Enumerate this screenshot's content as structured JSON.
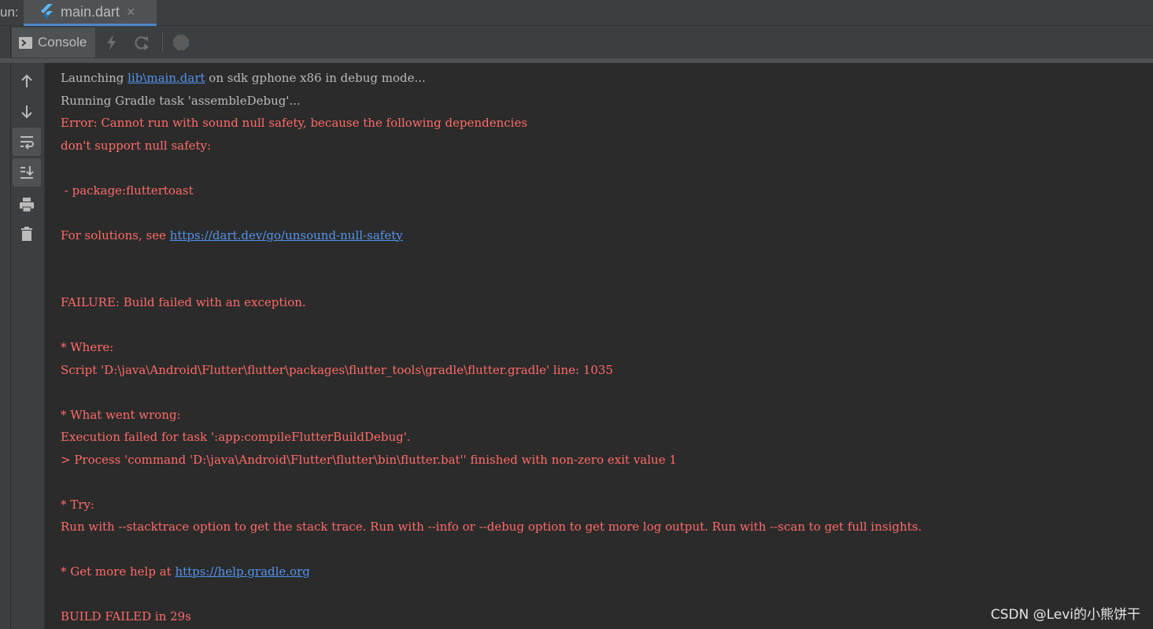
{
  "run_label": "un:",
  "tab": {
    "name": "main.dart",
    "close": "×",
    "icon": "flutter-icon"
  },
  "toolbar": {
    "console_label": "Console",
    "icons": [
      "console-icon",
      "lightning-icon",
      "hot-restart-icon",
      "stop-icon"
    ]
  },
  "gutter_icons": [
    "arrow-up-icon",
    "arrow-down-icon",
    "soft-wrap-icon",
    "scroll-to-end-icon",
    "print-icon",
    "trash-icon"
  ],
  "console": {
    "l1_pre": "Launching ",
    "l1_link": "lib\\main.dart",
    "l1_post": " on sdk gphone x86 in debug mode...",
    "l2": "Running Gradle task 'assembleDebug'...",
    "l3": "Error: Cannot run with sound null safety, because the following dependencies",
    "l4": "don't support null safety:",
    "l6": " - package:fluttertoast",
    "l8_pre": "For solutions, see ",
    "l8_link": "https://dart.dev/go/unsound-null-safety",
    "l11": "FAILURE: Build failed with an exception.",
    "l13": "* Where:",
    "l14": "Script 'D:\\java\\Android\\Flutter\\flutter\\packages\\flutter_tools\\gradle\\flutter.gradle' line: 1035",
    "l16": "* What went wrong:",
    "l17": "Execution failed for task ':app:compileFlutterBuildDebug'.",
    "l18": "> Process 'command 'D:\\java\\Android\\Flutter\\flutter\\bin\\flutter.bat'' finished with non-zero exit value 1",
    "l20": "* Try:",
    "l21": "Run with --stacktrace option to get the stack trace. Run with --info or --debug option to get more log output. Run with --scan to get full insights.",
    "l23_pre": "* Get more help at ",
    "l23_link": "https://help.gradle.org",
    "l25": "BUILD FAILED in 29s"
  },
  "colors": {
    "error": "#ff6b68",
    "link": "#5394ec",
    "text": "#bbbbbb",
    "background": "#2b2b2b"
  },
  "watermark": "CSDN @Levi的小熊饼干"
}
